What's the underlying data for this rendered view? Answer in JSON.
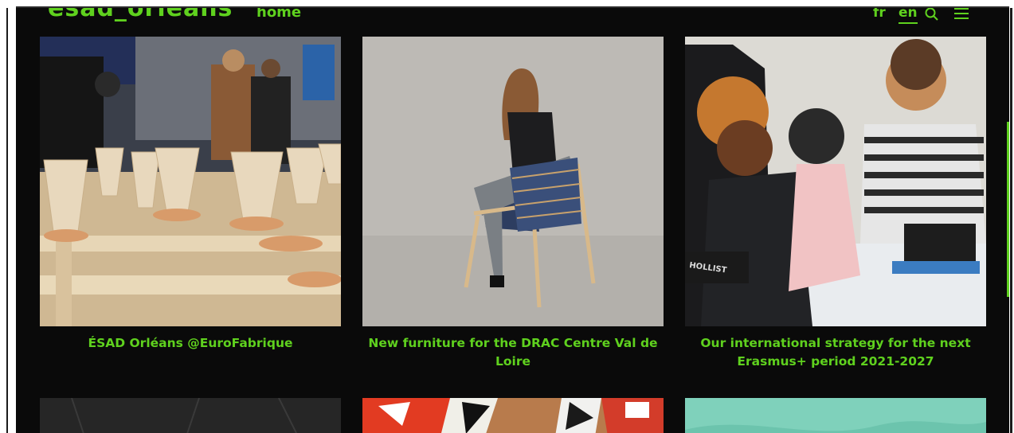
{
  "header": {
    "brand": "ésad_orléans",
    "nav_home": "home",
    "lang_fr": "fr",
    "lang_en": "en",
    "icons": [
      "search-icon",
      "menu-icon"
    ]
  },
  "colors": {
    "accent": "#5fd11e",
    "background": "#0a0a0a"
  },
  "articles": [
    {
      "title": "ÉSAD Orléans @EuroFabrique",
      "image": "ceramic-vases-exhibition"
    },
    {
      "title": "New furniture for the DRAC Centre Val de Loire",
      "image": "woman-on-woven-chair"
    },
    {
      "title": "Our international strategy for the next Erasmus+ period 2021-2027",
      "image": "students-workshop"
    },
    {
      "title": "",
      "image": "dark-texture"
    },
    {
      "title": "",
      "image": "colorful-collage"
    },
    {
      "title": "",
      "image": "turquoise-painting"
    }
  ]
}
